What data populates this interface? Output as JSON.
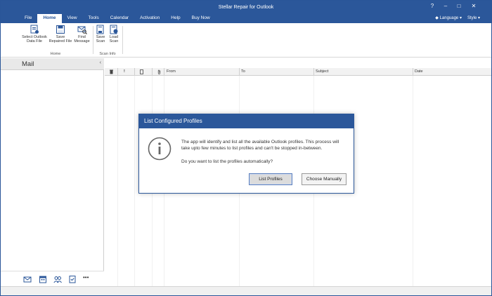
{
  "app": {
    "title": "Stellar Repair for Outlook"
  },
  "window_controls": {
    "help": "?",
    "minimize": "–",
    "maximize": "□",
    "close": "✕"
  },
  "menu": [
    "File",
    "Home",
    "View",
    "Tools",
    "Calendar",
    "Activation",
    "Help",
    "Buy Now"
  ],
  "menu_active": "Home",
  "right_menu": {
    "language": "Language",
    "style": "Style"
  },
  "ribbon": {
    "home_group": {
      "label": "Home",
      "buttons": [
        {
          "line1": "Select Outlook",
          "line2": "Data File",
          "icon": "select-file-icon"
        },
        {
          "line1": "Save",
          "line2": "Repaired File",
          "icon": "save-icon"
        },
        {
          "line1": "Find",
          "line2": "Message",
          "icon": "find-message-icon"
        }
      ]
    },
    "scan_group": {
      "label": "Scan Info",
      "buttons": [
        {
          "line1": "Save",
          "line2": "Scan",
          "icon": "save-scan-icon"
        },
        {
          "line1": "Load",
          "line2": "Scan",
          "icon": "load-scan-icon"
        }
      ]
    }
  },
  "left_pane": {
    "title": "Mail",
    "collapse": "‹",
    "nav_icons": [
      "mail-icon",
      "calendar-icon",
      "contacts-icon",
      "tasks-icon",
      "more-icon"
    ],
    "more": "•••"
  },
  "grid": {
    "icon_columns": [
      "delete-icon",
      "importance-icon",
      "document-icon",
      "attachment-icon"
    ],
    "columns": [
      "From",
      "To",
      "Subject",
      "Date"
    ]
  },
  "dialog": {
    "title": "List Configured Profiles",
    "message": "The app will identify and list all the available Outlook profiles. This process will take upto few minutes to list profiles and can't be stopped in-between.",
    "question": "Do you want to list the profiles automatically?",
    "primary_button": "List Profiles",
    "secondary_button": "Choose Manually"
  },
  "colors": {
    "accent": "#2b579a"
  }
}
